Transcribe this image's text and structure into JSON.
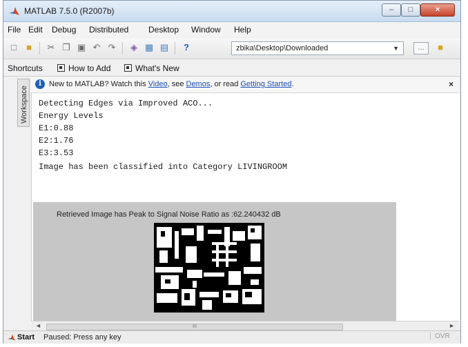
{
  "window": {
    "title": "MATLAB  7.5.0 (R2007b)"
  },
  "title_buttons": {
    "minimize": "–",
    "maximize": "□",
    "close": "×"
  },
  "menu": [
    "File",
    "Edit",
    "Debug",
    "Distributed",
    "Desktop",
    "Window",
    "Help"
  ],
  "toolbar": {
    "icons": [
      "new-file",
      "open-folder",
      "cut",
      "copy",
      "paste",
      "undo",
      "redo",
      "simulink",
      "guide",
      "profiler",
      "help"
    ],
    "current_directory": "zbika\\Desktop\\Downloaded",
    "browse_label": "...",
    "dropdown_arrow": "▼"
  },
  "shortcuts": {
    "label": "Shortcuts",
    "items": [
      "How to Add",
      "What's New"
    ]
  },
  "workspace_tab": "Workspace",
  "info_bar": {
    "prefix": "New to MATLAB? Watch this ",
    "link_video": "Video",
    "mid1": ", see ",
    "link_demos": "Demos",
    "mid2": ", or read ",
    "link_started": "Getting Started",
    "suffix": ".",
    "close": "×"
  },
  "command_window": {
    "lines": [
      "Detecting Edges via Improved ACO...",
      "Energy Levels",
      "E1:0.88",
      "E2:1.76",
      "E3:3.53",
      "Image has been classified into Category LIVINGROOM"
    ]
  },
  "figure": {
    "caption": "Retrieved Image has Peak to Signal Noise Ratio as :62.240432 dB"
  },
  "scrollbar": {
    "left": "◄",
    "right": "►",
    "grip": "III"
  },
  "status_bar": {
    "start": "Start",
    "status": "Paused: Press any key",
    "mode": "OVR"
  },
  "colors": {
    "link": "#1a4fb5",
    "matlab_logo": "#d9431e",
    "figure_bg": "#c6c6c6"
  }
}
